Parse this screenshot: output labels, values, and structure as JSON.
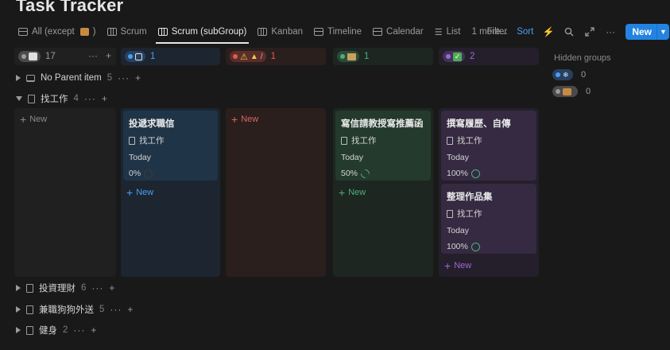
{
  "title": "Task Tracker",
  "tabs": [
    {
      "label": "All (except",
      "icon": "table-icon"
    },
    {
      "label": "Scrum",
      "icon": "board-icon"
    },
    {
      "label": "Scrum (subGroup)",
      "icon": "board-icon"
    },
    {
      "label": "Kanban",
      "icon": "board-icon"
    },
    {
      "label": "Timeline",
      "icon": "timeline-icon"
    },
    {
      "label": "Calendar",
      "icon": "calendar-icon"
    },
    {
      "label": "List",
      "icon": "list-icon"
    },
    {
      "label": "1 more..."
    }
  ],
  "tab_suffix": ")",
  "toolbar": {
    "filter": "Filter",
    "sort": "Sort",
    "new": "New",
    "more": "···"
  },
  "columns": [
    {
      "count": "17",
      "color": "#9b9b9b"
    },
    {
      "count": "1",
      "color": "#4a9ff5"
    },
    {
      "count": "1",
      "color": "#e05a4f"
    },
    {
      "count": "1",
      "color": "#4caf7a"
    },
    {
      "count": "2",
      "color": "#a066d8"
    }
  ],
  "header_actions": {
    "more": "···",
    "add": "+"
  },
  "groups": {
    "no_parent": {
      "label": "No Parent item",
      "count": "5"
    },
    "job": {
      "label": "找工作",
      "count": "4"
    },
    "invest": {
      "label": "投資理財",
      "count": "6"
    },
    "dogwalk": {
      "label": "兼職狗狗外送",
      "count": "5"
    },
    "fitness": {
      "label": "健身",
      "count": "2"
    }
  },
  "group_more": "···",
  "group_add": "+",
  "new_label": "New",
  "cards": [
    {
      "title": "投遞求職信",
      "relation": "找工作",
      "date": "Today",
      "progress": "0%",
      "progress_value": 0
    },
    {
      "title": "寫信請教授寫推薦函",
      "relation": "找工作",
      "date": "Today",
      "progress": "50%",
      "progress_value": 0.5
    },
    {
      "title": "撰寫履歷、自傳",
      "relation": "找工作",
      "date": "Today",
      "progress": "100%",
      "progress_value": 1
    },
    {
      "title": "整理作品集",
      "relation": "找工作",
      "date": "Today",
      "progress": "100%",
      "progress_value": 1
    }
  ],
  "hidden_groups": {
    "label": "Hidden groups",
    "items": [
      {
        "count": "0",
        "color": "#4a9ff5"
      },
      {
        "count": "0",
        "color": "#9b9b9b"
      }
    ]
  }
}
